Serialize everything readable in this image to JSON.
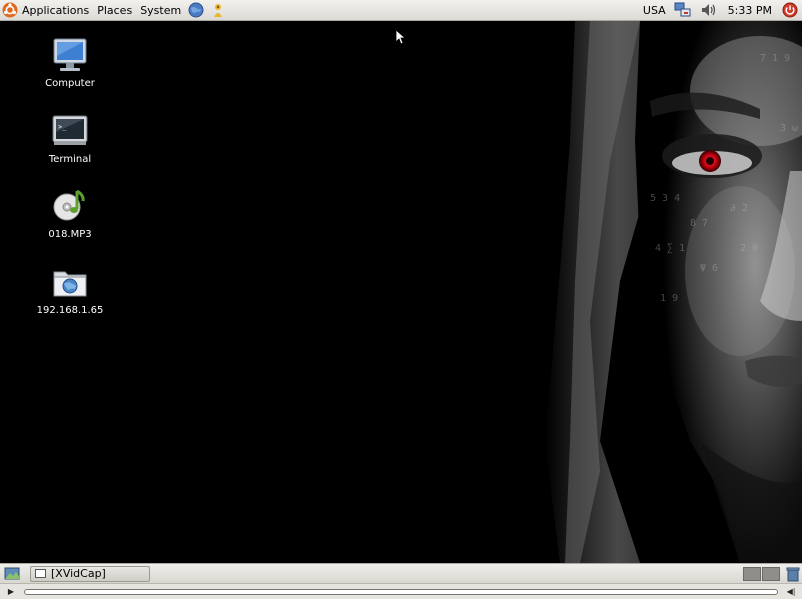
{
  "top_panel": {
    "menus": [
      {
        "label": "Applications"
      },
      {
        "label": "Places"
      },
      {
        "label": "System"
      }
    ],
    "launchers": [
      "web-browser-icon",
      "help-icon"
    ],
    "keyboard_layout": "USA",
    "tray_icons": [
      "network-icon",
      "volume-icon"
    ],
    "clock": "5:33 PM",
    "shutdown_icon": "power-icon"
  },
  "desktop": {
    "icons": [
      {
        "label": "Computer",
        "icon": "computer-icon"
      },
      {
        "label": "Terminal",
        "icon": "terminal-icon"
      },
      {
        "label": "018.MP3",
        "icon": "audio-file-icon"
      },
      {
        "label": "192.168.1.65",
        "icon": "network-share-icon"
      }
    ]
  },
  "bottom_panel": {
    "tasks": [
      {
        "label": "[XVidCap]"
      }
    ],
    "workspaces": 2
  },
  "player": {
    "progress": 0.0
  },
  "colors": {
    "panel": "#dcdad5",
    "desktop": "#000000",
    "eye": "#e0101a"
  }
}
